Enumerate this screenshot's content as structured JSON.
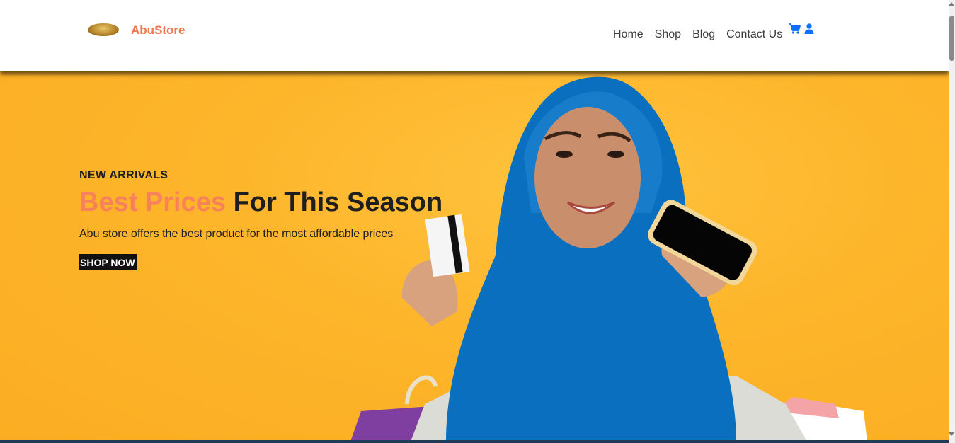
{
  "brand": {
    "name": "AbuStore"
  },
  "nav": {
    "items": [
      {
        "label": "Home"
      },
      {
        "label": "Shop"
      },
      {
        "label": "Blog"
      },
      {
        "label": "Contact Us"
      }
    ]
  },
  "icons": {
    "cart": "cart-icon",
    "user": "user-icon",
    "color": "#0d6efd"
  },
  "hero": {
    "subtitle": "NEW ARRIVALS",
    "title_accent": "Best Prices",
    "title_rest": "For This Season",
    "description": "Abu store offers the best product for the most affordable prices",
    "cta_label": "SHOP NOW",
    "background_color": "#fdb52a",
    "accent_color": "#f7825a"
  }
}
